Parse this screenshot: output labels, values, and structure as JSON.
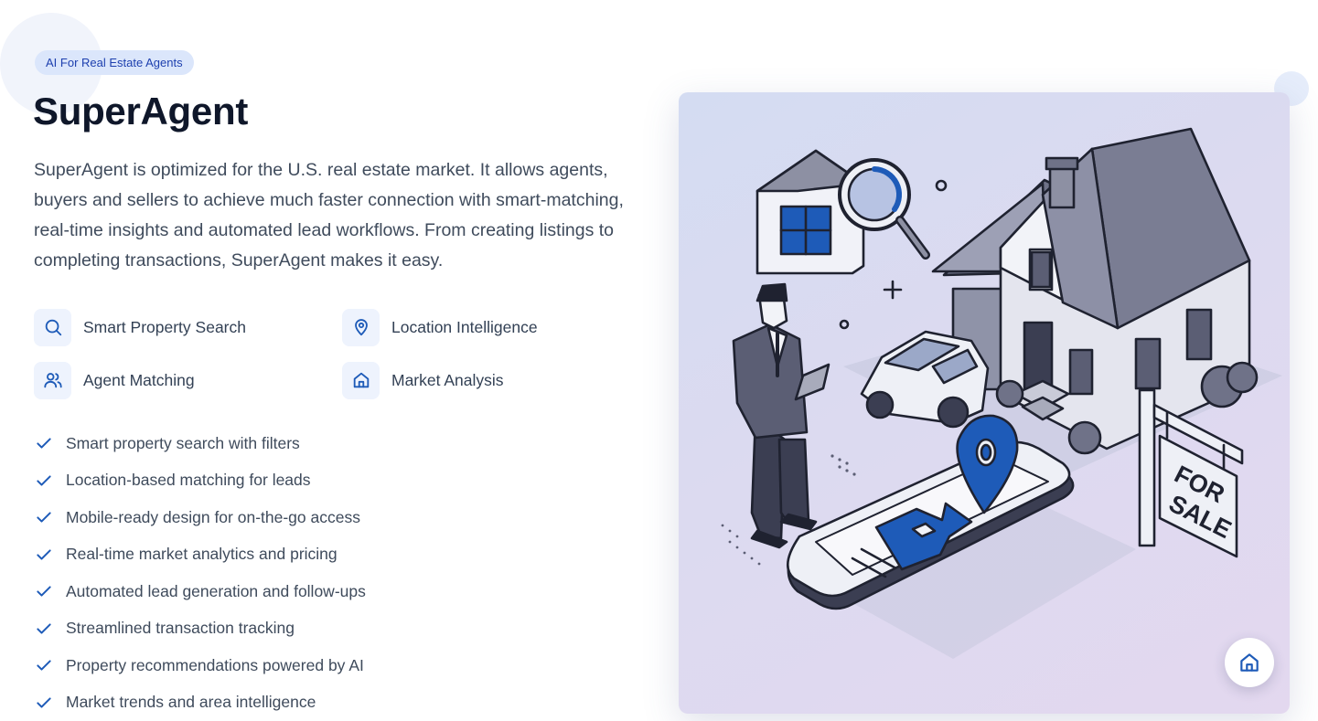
{
  "hero": {
    "badge": "AI For Real Estate Agents",
    "title": "SuperAgent",
    "description": "SuperAgent is optimized for the U.S. real estate market. It allows agents, buyers and sellers to achieve much faster connection with smart-matching, real-time insights and automated lead workflows. From creating listings to completing transactions, SuperAgent makes it easy."
  },
  "features": [
    {
      "label": "Smart Property Search",
      "icon": "search-icon"
    },
    {
      "label": "Location Intelligence",
      "icon": "map-pin-icon"
    },
    {
      "label": "Agent Matching",
      "icon": "users-icon"
    },
    {
      "label": "Market Analysis",
      "icon": "home-icon"
    }
  ],
  "checklist": [
    "Smart property search with filters",
    "Location-based matching for leads",
    "Mobile-ready design for on-the-go access",
    "Real-time market analytics and pricing",
    "Automated lead generation and follow-ups",
    "Streamlined transaction tracking",
    "Property recommendations powered by AI",
    "Market trends and area intelligence"
  ],
  "illustration": {
    "sign_line1": "FOR",
    "sign_line2": "SALE"
  },
  "colors": {
    "accent": "#1e5bb8",
    "badge_bg": "#dbe6fb",
    "badge_text": "#1e40af",
    "title": "#0f172a",
    "icon_tile_bg": "#eef3fd"
  }
}
